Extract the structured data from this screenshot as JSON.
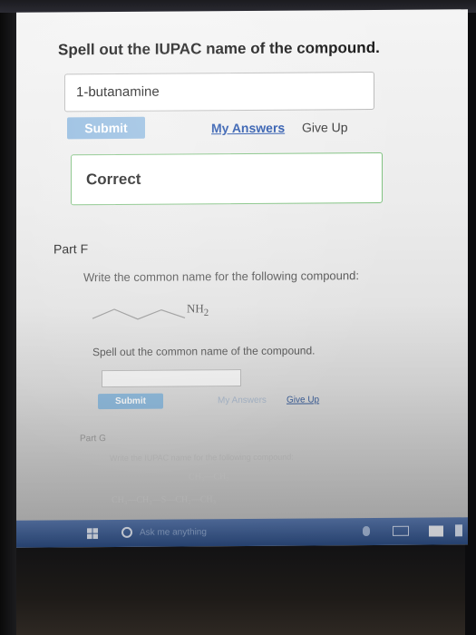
{
  "question": {
    "title": "Spell out the IUPAC name of the compound.",
    "answer_value": "1-butanamine",
    "submit_label": "Submit",
    "my_answers_label": "My Answers",
    "give_up_label": "Give Up",
    "feedback": "Correct"
  },
  "part_f": {
    "heading": "Part F",
    "instruction": "Write the common name for the following compound:",
    "group_label": "NH",
    "group_subscript": "2",
    "spell_prompt": "Spell out the common name of the compound.",
    "answer_value": "",
    "submit_label": "Submit",
    "my_answers_label": "My Answers",
    "give_up_label": "Give Up"
  },
  "part_g": {
    "heading": "Part G",
    "instruction": "Write the IUPAC name for the following compound:",
    "structure_line1": "CH₃—CH₂",
    "structure_line2": "CH₃—CH₂—S—CH₂—CH₃"
  },
  "taskbar": {
    "search_placeholder": "Ask me anything",
    "accent_color": "#2e4f86"
  },
  "colors": {
    "submit_active": "#90b9df",
    "link": "#1f4ea8",
    "correct_border": "#7dc07d"
  }
}
